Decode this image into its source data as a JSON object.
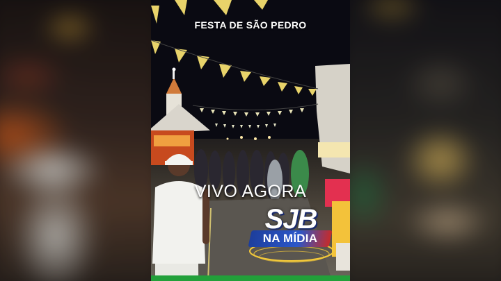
{
  "overlay": {
    "title": "FESTA DE SÃO PEDRO",
    "live_text": "VIVO AGORA",
    "logo_main": "SJB",
    "logo_tag": "NA MÍDIA"
  },
  "colors": {
    "bunting_yellow": "#e8d36a",
    "logo_blue": "#2b57c9",
    "logo_red": "#c62b2b",
    "bottom_bar": "#22a03a"
  }
}
